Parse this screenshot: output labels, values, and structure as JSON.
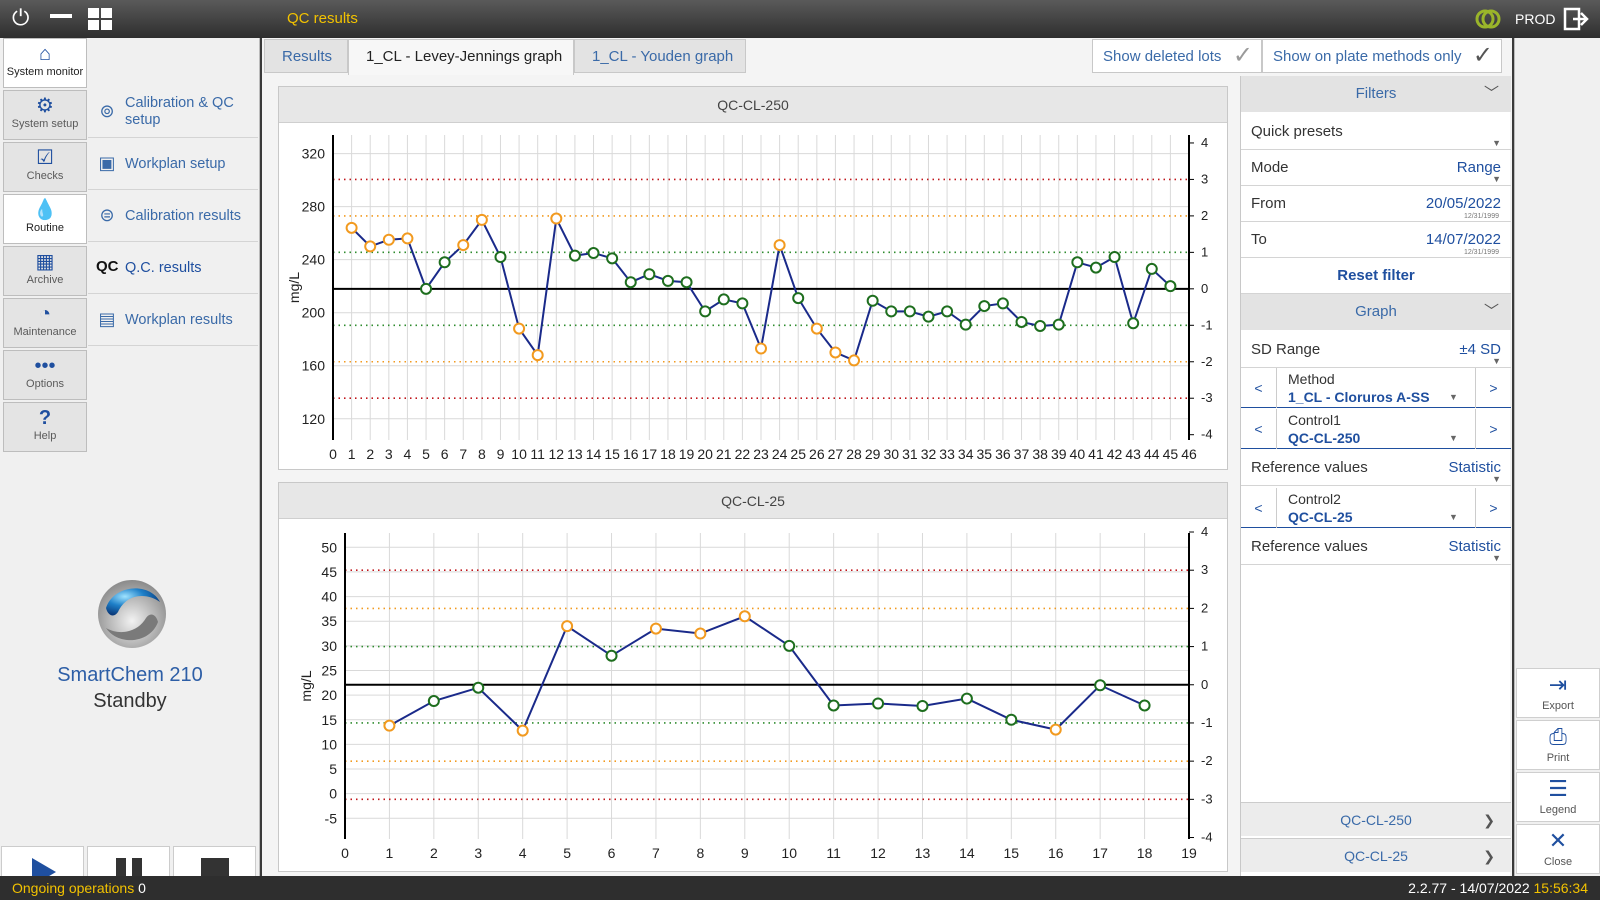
{
  "topbar": {
    "title": "QC results",
    "env": "PROD"
  },
  "nav": {
    "items": [
      {
        "label": "System monitor"
      },
      {
        "label": "System setup"
      },
      {
        "label": "Checks"
      },
      {
        "label": "Routine"
      },
      {
        "label": "Archive"
      },
      {
        "label": "Maintenance"
      },
      {
        "label": "Options"
      },
      {
        "label": "Help"
      }
    ]
  },
  "submenu": {
    "items": [
      {
        "label": "Calibration & QC setup"
      },
      {
        "label": "Workplan setup"
      },
      {
        "label": "Calibration results"
      },
      {
        "label": "Q.C. results",
        "icon_text": "QC"
      },
      {
        "label": "Workplan results"
      }
    ]
  },
  "device": {
    "name": "SmartChem 210",
    "state": "Standby"
  },
  "tabs": [
    {
      "label": "Results"
    },
    {
      "label": "1_CL - Levey-Jennings graph"
    },
    {
      "label": "1_CL - Youden graph"
    }
  ],
  "toggles": {
    "deleted_lots": "Show deleted lots",
    "plate_methods": "Show on plate methods only"
  },
  "filters": {
    "header": "Filters",
    "quick_presets": "Quick presets",
    "mode_label": "Mode",
    "mode_value": "Range",
    "from_label": "From",
    "from_value": "20/05/2022",
    "to_label": "To",
    "to_value": "14/07/2022",
    "date_hint": "12/31/1999",
    "reset": "Reset filter"
  },
  "graph": {
    "header": "Graph",
    "sd_label": "SD Range",
    "sd_value": "±4 SD",
    "method_label": "Method",
    "method_value": "1_CL - Cloruros A-SS",
    "control1_label": "Control1",
    "control1_value": "QC-CL-250",
    "ref1_label": "Reference values",
    "ref1_value": "Statistic",
    "control2_label": "Control2",
    "control2_value": "QC-CL-25",
    "ref2_label": "Reference values",
    "ref2_value": "Statistic"
  },
  "nav_bottom": {
    "qc1": "QC-CL-250",
    "qc2": "QC-CL-25"
  },
  "actions": [
    {
      "label": "Export"
    },
    {
      "label": "Print"
    },
    {
      "label": "Legend"
    },
    {
      "label": "Close"
    }
  ],
  "status": {
    "ongoing_label": "Ongoing operations",
    "ongoing_count": "0",
    "version_date": "2.2.77 - 14/07/2022",
    "time": "15:56:34"
  },
  "colors": {
    "line": "#1a2a8a",
    "in_control": "#1e6e1e",
    "warning": "#f29a1f",
    "mean_line": "#000000",
    "sd1": "#2e8b2e",
    "sd2": "#f29a1f",
    "sd3": "#c0141a",
    "accent": "#1f4f9f",
    "title_yellow": "#f2c200"
  },
  "chart_data": [
    {
      "type": "line",
      "title": "QC-CL-250",
      "ylabel": "mg/L",
      "xlim": [
        0,
        46
      ],
      "ylim": [
        104,
        334
      ],
      "yticks": [
        120,
        160,
        200,
        240,
        280,
        320
      ],
      "sd_ticks": [
        4,
        3,
        2,
        1,
        0,
        -1,
        -2,
        -3,
        -4
      ],
      "mean": 218,
      "sd": 27.5,
      "grid": true,
      "x": [
        1,
        2,
        3,
        4,
        5,
        6,
        7,
        8,
        9,
        10,
        11,
        12,
        13,
        14,
        15,
        16,
        17,
        18,
        19,
        20,
        21,
        22,
        23,
        24,
        25,
        26,
        27,
        28,
        29,
        30,
        31,
        32,
        33,
        34,
        35,
        36,
        37,
        38,
        39,
        40,
        41,
        42,
        43,
        44,
        45
      ],
      "values": [
        264,
        250,
        255,
        256,
        218,
        238,
        251,
        270,
        242,
        188,
        168,
        271,
        243,
        245,
        241,
        223,
        229,
        224,
        223,
        201,
        210,
        207,
        173,
        251,
        211,
        188,
        170,
        164,
        209,
        201,
        201,
        197,
        201,
        191,
        205,
        207,
        193,
        190,
        191,
        238,
        234,
        242,
        192,
        233,
        220
      ],
      "status": [
        "w",
        "w",
        "w",
        "w",
        "ok",
        "ok",
        "w",
        "w",
        "ok",
        "w",
        "w",
        "w",
        "ok",
        "ok",
        "ok",
        "ok",
        "ok",
        "ok",
        "ok",
        "ok",
        "ok",
        "ok",
        "w",
        "w",
        "ok",
        "w",
        "w",
        "w",
        "ok",
        "ok",
        "ok",
        "ok",
        "ok",
        "ok",
        "ok",
        "ok",
        "ok",
        "ok",
        "ok",
        "ok",
        "ok",
        "ok",
        "ok",
        "ok",
        "ok"
      ]
    },
    {
      "type": "line",
      "title": "QC-CL-25",
      "ylabel": "mg/L",
      "xlim": [
        0,
        19
      ],
      "ylim": [
        -9.2,
        52.9
      ],
      "yticks": [
        -5,
        0,
        5,
        10,
        15,
        20,
        25,
        30,
        35,
        40,
        45,
        50
      ],
      "sd_ticks": [
        4,
        3,
        2,
        1,
        0,
        -1,
        -2,
        -3,
        -4
      ],
      "mean": 22.1,
      "sd": 7.75,
      "grid": true,
      "x": [
        1,
        2,
        3,
        4,
        5,
        6,
        7,
        8,
        9,
        10,
        11,
        12,
        13,
        14,
        15,
        16,
        17,
        18
      ],
      "values": [
        13.8,
        18.8,
        21.5,
        12.8,
        34.0,
        28.0,
        33.5,
        32.5,
        36.0,
        30.0,
        17.9,
        18.3,
        17.8,
        19.3,
        15.0,
        13.0,
        22.0,
        17.9
      ],
      "status": [
        "w",
        "ok",
        "ok",
        "w",
        "w",
        "ok",
        "w",
        "w",
        "w",
        "ok",
        "ok",
        "ok",
        "ok",
        "ok",
        "ok",
        "w",
        "ok",
        "ok"
      ]
    }
  ]
}
